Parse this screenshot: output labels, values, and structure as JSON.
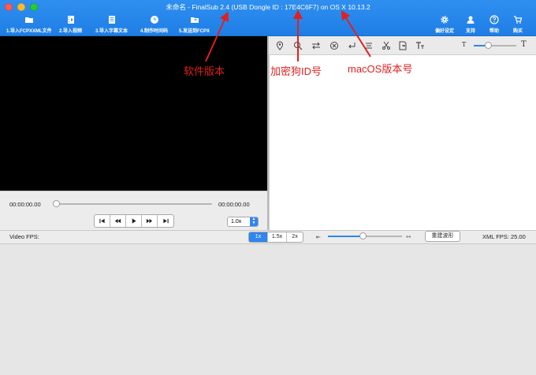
{
  "window": {
    "title": "未命名 - FinalSub 2.4 (USB Dongle ID : 17E4C6F7) on OS X 10.13.2"
  },
  "toolbar": {
    "items": [
      {
        "label": "1.导入FCPXXML文件",
        "icon": "folder-icon"
      },
      {
        "label": "2.导入视频",
        "icon": "film-icon"
      },
      {
        "label": "3.导入字幕文本",
        "icon": "document-icon"
      },
      {
        "label": "4.制作时间码",
        "icon": "clock-icon"
      },
      {
        "label": "5.发送到FCPX",
        "icon": "send-folder-icon"
      }
    ],
    "right_items": [
      {
        "label": "偏好设定",
        "icon": "gear-icon"
      },
      {
        "label": "支持",
        "icon": "person-icon"
      },
      {
        "label": "帮助",
        "icon": "help-icon"
      },
      {
        "label": "购买",
        "icon": "cart-icon"
      }
    ]
  },
  "player": {
    "current_time": "00:00:00.00",
    "total_time": "00:00:00.00",
    "playback_position": 0,
    "rate": "1.0x"
  },
  "editor_tools": [
    "location-pin-icon",
    "search-icon",
    "swap-icon",
    "close-circle-icon",
    "return-icon",
    "align-icon",
    "scissors-icon",
    "document-icon",
    "text-format-icon"
  ],
  "text_size": {
    "small": "T",
    "large": "T",
    "level": 0.3
  },
  "bottom_bar": {
    "video_fps_label": "Video FPS:",
    "speed_options": [
      "1x",
      "1.5x",
      "2x"
    ],
    "speed_selected": "1x",
    "waveform_level": 0.48,
    "rebuild_label": "重建波形",
    "xml_fps_label": "XML FPS: 25.00"
  },
  "annotations": {
    "software_version": "软件版本",
    "dongle_id": "加密狗ID号",
    "macos_version": "macOS版本号"
  },
  "colors": {
    "titlebar": "#2a8bee",
    "accent": "#2f86ee",
    "annotation": "#e02020"
  }
}
